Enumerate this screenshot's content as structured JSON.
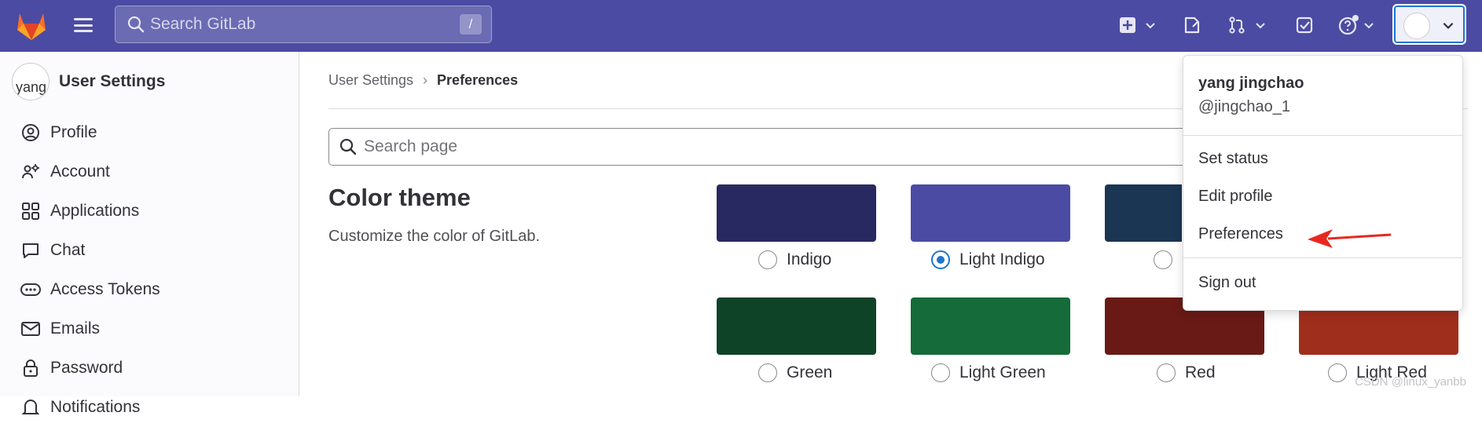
{
  "topbar": {
    "search_placeholder": "Search GitLab",
    "search_shortcut": "/",
    "icons": [
      "tanuki-logo",
      "hamburger-icon",
      "search-icon",
      "plus-square-icon",
      "issues-icon",
      "merge-request-icon",
      "todo-icon",
      "help-icon",
      "avatar"
    ]
  },
  "sidebar": {
    "title": "User Settings",
    "avatar_alt": "yang",
    "items": [
      {
        "label": "Profile",
        "icon": "profile-icon"
      },
      {
        "label": "Account",
        "icon": "account-icon"
      },
      {
        "label": "Applications",
        "icon": "applications-icon"
      },
      {
        "label": "Chat",
        "icon": "chat-icon"
      },
      {
        "label": "Access Tokens",
        "icon": "token-icon"
      },
      {
        "label": "Emails",
        "icon": "mail-icon"
      },
      {
        "label": "Password",
        "icon": "lock-icon"
      },
      {
        "label": "Notifications",
        "icon": "bell-icon"
      }
    ]
  },
  "breadcrumb": {
    "parent": "User Settings",
    "separator": "›",
    "current": "Preferences"
  },
  "page_search": {
    "placeholder": "Search page"
  },
  "color_theme": {
    "title": "Color theme",
    "description": "Customize the color of GitLab.",
    "themes": [
      {
        "label": "Indigo",
        "color": "#292961",
        "selected": false
      },
      {
        "label": "Light Indigo",
        "color": "#4b4ba3",
        "selected": true
      },
      {
        "label": "",
        "color": "#1a3652",
        "selected": false
      },
      {
        "label": "Green",
        "color": "#0e4328",
        "selected": false
      },
      {
        "label": "Light Green",
        "color": "#156b39",
        "selected": false
      },
      {
        "label": "Red",
        "color": "#691a16",
        "selected": false
      },
      {
        "label": "Light Red",
        "color": "#a02e1c",
        "selected": false
      }
    ]
  },
  "user_menu": {
    "name": "yang jingchao",
    "username": "@jingchao_1",
    "items": [
      "Set status",
      "Edit profile",
      "Preferences",
      "Sign out"
    ]
  },
  "watermark": "CSDN @linux_yanbb",
  "colors": {
    "topbar": "#4b4ba3",
    "accent": "#1f75cb",
    "annotation_arrow": "#e8281e"
  }
}
